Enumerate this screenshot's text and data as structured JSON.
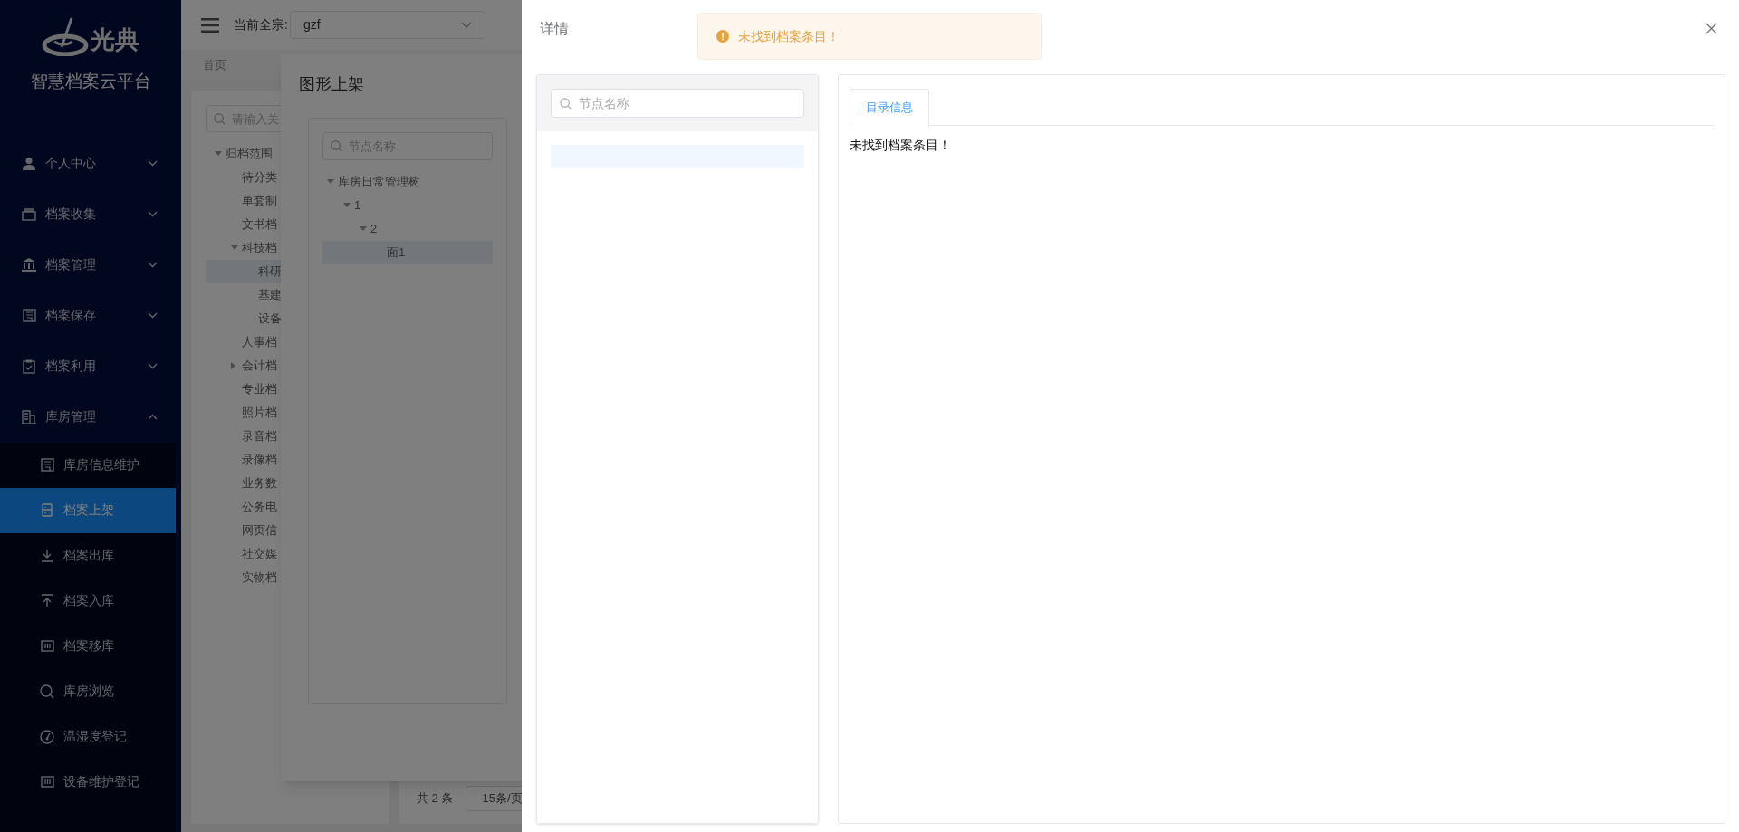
{
  "sidebar": {
    "logo_text": "光典",
    "platform_name": "智慧档案云平台",
    "items": [
      {
        "label": "个人中心",
        "expanded": false
      },
      {
        "label": "档案收集",
        "expanded": false
      },
      {
        "label": "档案管理",
        "expanded": false
      },
      {
        "label": "档案保存",
        "expanded": false
      },
      {
        "label": "档案利用",
        "expanded": false
      },
      {
        "label": "库房管理",
        "expanded": true,
        "children": [
          {
            "label": "库房信息维护",
            "selected": false
          },
          {
            "label": "档案上架",
            "selected": true
          },
          {
            "label": "档案出库",
            "selected": false
          },
          {
            "label": "档案入库",
            "selected": false
          },
          {
            "label": "档案移库",
            "selected": false
          },
          {
            "label": "库房浏览",
            "selected": false
          },
          {
            "label": "温湿度登记",
            "selected": false
          },
          {
            "label": "设备维护登记",
            "selected": false
          }
        ]
      }
    ]
  },
  "header": {
    "fonds_label": "当前全宗:",
    "fonds_value": "gzf"
  },
  "page_tabs": [
    {
      "label": "首页",
      "selected": false
    }
  ],
  "archive_tree": {
    "placeholder": "请输入关",
    "nodes": [
      {
        "label": "归档范围",
        "expanded": true,
        "selected": false,
        "children": [
          {
            "label": "待分类",
            "selected": false
          },
          {
            "label": "单套制",
            "selected": false
          },
          {
            "label": "文书档",
            "selected": false
          },
          {
            "label": "科技档",
            "expanded": true,
            "selected": false,
            "children": [
              {
                "label": "科研",
                "selected": true
              },
              {
                "label": "基建",
                "selected": false
              },
              {
                "label": "设备",
                "selected": false
              }
            ]
          },
          {
            "label": "人事档",
            "selected": false
          },
          {
            "label": "会计档",
            "expanded": false,
            "selected": false
          },
          {
            "label": "专业档",
            "selected": false
          },
          {
            "label": "照片档",
            "selected": false
          },
          {
            "label": "录音档",
            "selected": false
          },
          {
            "label": "录像档",
            "selected": false
          },
          {
            "label": "业务数",
            "selected": false
          },
          {
            "label": "公务电",
            "selected": false
          },
          {
            "label": "网页信",
            "selected": false
          },
          {
            "label": "社交媒",
            "selected": false
          },
          {
            "label": "实物档",
            "selected": false
          }
        ]
      }
    ]
  },
  "pagination": {
    "total": "共 2 条",
    "page_size": "15条/页"
  },
  "shelve_dialog": {
    "title": "图形上架",
    "placeholder": "节点名称",
    "nodes": [
      {
        "label": "库房日常管理树",
        "expanded": true,
        "selected": false,
        "children": [
          {
            "label": "1",
            "expanded": true,
            "selected": false,
            "children": [
              {
                "label": "2",
                "expanded": true,
                "selected": false,
                "children": [
                  {
                    "label": "面1",
                    "selected": true
                  }
                ]
              }
            ]
          }
        ]
      }
    ]
  },
  "drawer": {
    "title": "详情",
    "placeholder": "节点名称",
    "tabs": [
      {
        "label": "目录信息",
        "selected": true
      }
    ],
    "content": "未找到档案条目！"
  },
  "message": {
    "kind": "warning",
    "text": "未找到档案条目！"
  }
}
